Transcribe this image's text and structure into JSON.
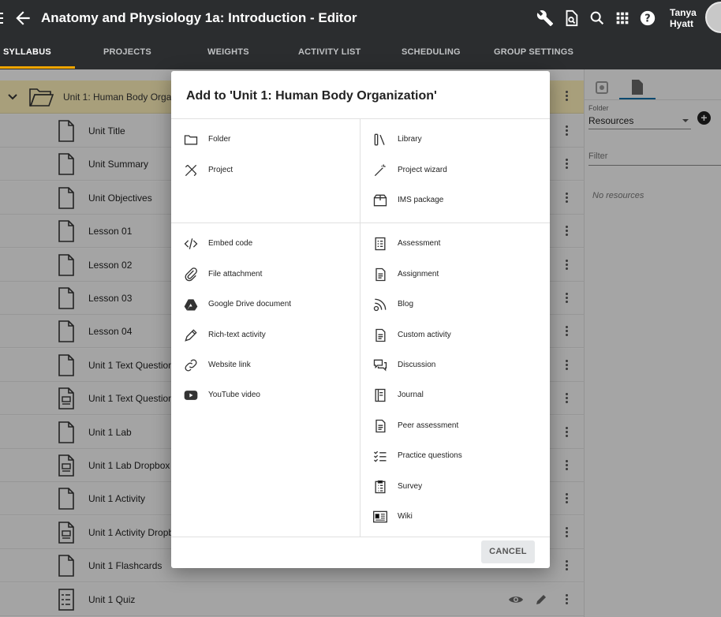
{
  "header": {
    "title": "Anatomy and Physiology 1a: Introduction - Editor",
    "user_first": "Tanya",
    "user_last": "Hyatt"
  },
  "tabs": [
    "SYLLABUS",
    "PROJECTS",
    "WEIGHTS",
    "ACTIVITY LIST",
    "SCHEDULING",
    "GROUP SETTINGS"
  ],
  "active_tab": "SYLLABUS",
  "unit": {
    "label": "Unit 1: Human Body Organization"
  },
  "rows": [
    {
      "label": "Unit Title",
      "icon": "document-icon"
    },
    {
      "label": "Unit Summary",
      "icon": "document-icon"
    },
    {
      "label": "Unit Objectives",
      "icon": "document-icon"
    },
    {
      "label": "Lesson 01",
      "icon": "document-icon"
    },
    {
      "label": "Lesson 02",
      "icon": "document-icon"
    },
    {
      "label": "Lesson 03",
      "icon": "document-icon"
    },
    {
      "label": "Lesson 04",
      "icon": "document-icon"
    },
    {
      "label": "Unit 1 Text Questions",
      "icon": "document-icon"
    },
    {
      "label": "Unit 1 Text Questions",
      "icon": "assignment-icon"
    },
    {
      "label": "Unit 1 Lab",
      "icon": "document-icon"
    },
    {
      "label": "Unit 1 Lab Dropbox",
      "icon": "assignment-icon"
    },
    {
      "label": "Unit 1 Activity",
      "icon": "document-icon"
    },
    {
      "label": "Unit 1 Activity Dropbox",
      "icon": "assignment-icon"
    },
    {
      "label": "Unit 1 Flashcards",
      "icon": "document-icon"
    },
    {
      "label": "Unit 1 Quiz",
      "icon": "quiz-icon"
    }
  ],
  "side_panel": {
    "folder_label": "Folder",
    "folder_value": "Resources",
    "filter_placeholder": "Filter",
    "empty_text": "No resources"
  },
  "dialog": {
    "title": "Add to 'Unit 1: Human Body Organization'",
    "section1_left": [
      {
        "label": "Folder",
        "icon": "folder-icon"
      },
      {
        "label": "Project",
        "icon": "project-icon"
      }
    ],
    "section1_right": [
      {
        "label": "Library",
        "icon": "library-icon"
      },
      {
        "label": "Project wizard",
        "icon": "wand-icon"
      },
      {
        "label": "IMS package",
        "icon": "package-icon"
      }
    ],
    "section2_left": [
      {
        "label": "Embed code",
        "icon": "code-icon"
      },
      {
        "label": "File attachment",
        "icon": "paperclip-icon"
      },
      {
        "label": "Google Drive document",
        "icon": "google-drive-icon"
      },
      {
        "label": "Rich-text activity",
        "icon": "pencil-icon"
      },
      {
        "label": "Website link",
        "icon": "link-icon"
      },
      {
        "label": "YouTube video",
        "icon": "youtube-icon"
      }
    ],
    "section2_right": [
      {
        "label": "Assessment",
        "icon": "assessment-icon"
      },
      {
        "label": "Assignment",
        "icon": "assignment-icon"
      },
      {
        "label": "Blog",
        "icon": "blog-icon"
      },
      {
        "label": "Custom activity",
        "icon": "custom-activity-icon"
      },
      {
        "label": "Discussion",
        "icon": "discussion-icon"
      },
      {
        "label": "Journal",
        "icon": "journal-icon"
      },
      {
        "label": "Peer assessment",
        "icon": "peer-assessment-icon"
      },
      {
        "label": "Practice questions",
        "icon": "checklist-icon"
      },
      {
        "label": "Survey",
        "icon": "survey-icon"
      },
      {
        "label": "Wiki",
        "icon": "wiki-icon"
      }
    ],
    "cancel_label": "CANCEL"
  },
  "colors": {
    "topbar": "#2b2d2f",
    "tab_accent": "#f0a500",
    "unit_row": "#fbeeb8",
    "side_accent": "#0b6ea6"
  }
}
